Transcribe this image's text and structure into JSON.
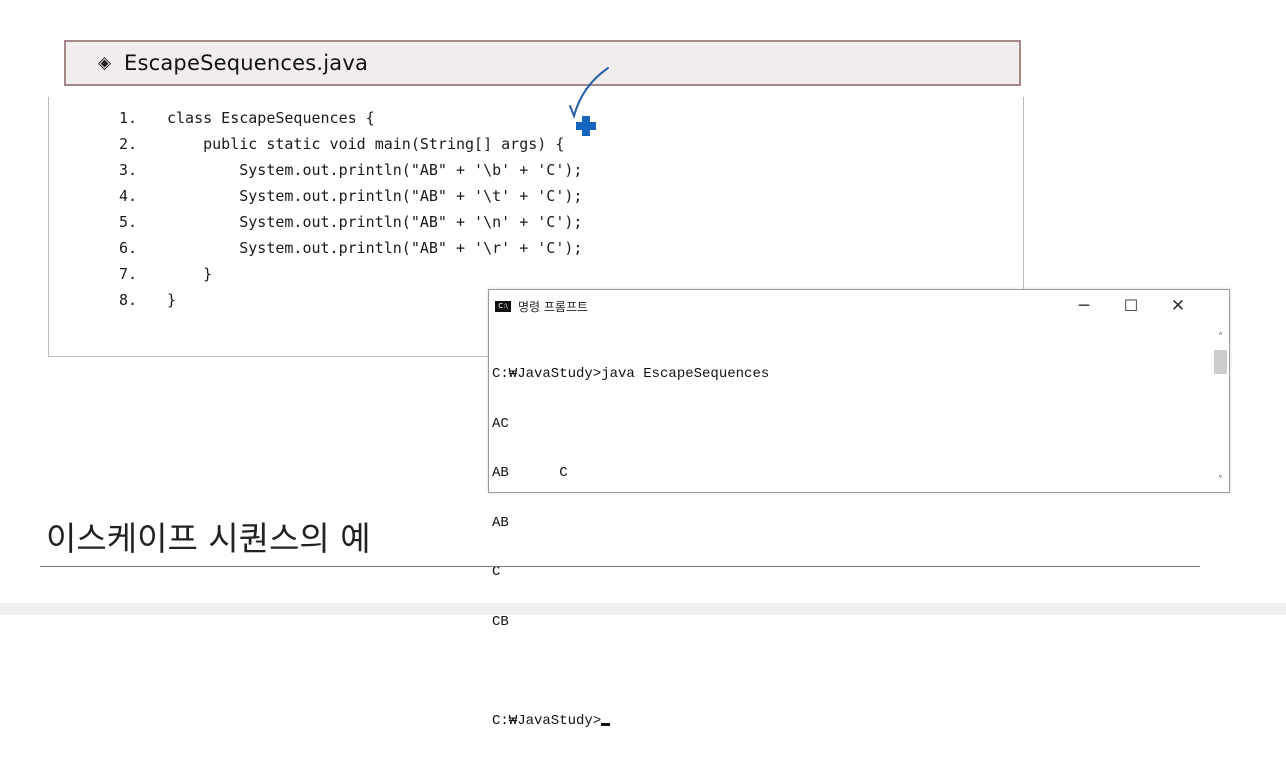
{
  "file_header": {
    "title": "EscapeSequences.java",
    "bullet": "◈"
  },
  "code_lines": [
    {
      "num": "1.",
      "text": "class EscapeSequences {"
    },
    {
      "num": "2.",
      "text": "    public static void main(String[] args) {"
    },
    {
      "num": "3.",
      "text": "        System.out.println(\"AB\" + '\\b' + 'C');"
    },
    {
      "num": "4.",
      "text": "        System.out.println(\"AB\" + '\\t' + 'C');"
    },
    {
      "num": "5.",
      "text": "        System.out.println(\"AB\" + '\\n' + 'C');"
    },
    {
      "num": "6.",
      "text": "        System.out.println(\"AB\" + '\\r' + 'C');"
    },
    {
      "num": "7.",
      "text": "    }"
    },
    {
      "num": "8.",
      "text": "}"
    }
  ],
  "cmd_window": {
    "icon_label": "C:\\",
    "title": "명령 프롬프트",
    "minimize": "─",
    "maximize": "☐",
    "close": "✕",
    "output_lines": [
      "C:₩JavaStudy>java EscapeSequences",
      "AC",
      "AB      C",
      "AB",
      "C",
      "CB",
      ""
    ],
    "prompt": "C:₩JavaStudy>",
    "scroll_up": "˄",
    "scroll_down": "˅"
  },
  "caption": "이스케이프 시퀀스의 예",
  "annotation": {
    "pen_color": "#2a5fa8",
    "cursor_color": "#1565c0"
  }
}
